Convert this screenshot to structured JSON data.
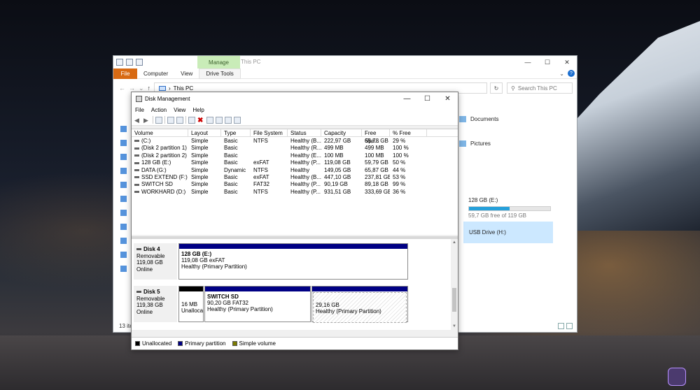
{
  "explorer": {
    "manage_tab": "Manage",
    "window_title": "This PC",
    "ribbon": {
      "file": "File",
      "computer": "Computer",
      "view": "View",
      "drive_tools": "Drive Tools"
    },
    "address": "This PC",
    "search_placeholder": "Search This PC",
    "folders": {
      "documents": "Documents",
      "pictures": "Pictures"
    },
    "drive_e": {
      "name": "128 GB (E:)",
      "free": "59,7 GB free of 119 GB",
      "used_fraction": 0.5
    },
    "drive_h": {
      "name": "USB Drive (H:)"
    },
    "status": "13 ite"
  },
  "disk_management": {
    "title": "Disk Management",
    "menu": [
      "File",
      "Action",
      "View",
      "Help"
    ],
    "columns": [
      "Volume",
      "Layout",
      "Type",
      "File System",
      "Status",
      "Capacity",
      "Free Spa...",
      "% Free"
    ],
    "volumes": [
      [
        "(C:)",
        "Simple",
        "Basic",
        "NTFS",
        "Healthy (B...",
        "222,97 GB",
        "65,78 GB",
        "29 %"
      ],
      [
        "(Disk 2 partition 1)",
        "Simple",
        "Basic",
        "",
        "Healthy (R...",
        "499 MB",
        "499 MB",
        "100 %"
      ],
      [
        "(Disk 2 partition 2)",
        "Simple",
        "Basic",
        "",
        "Healthy (E...",
        "100 MB",
        "100 MB",
        "100 %"
      ],
      [
        "128 GB (E:)",
        "Simple",
        "Basic",
        "exFAT",
        "Healthy (P...",
        "119,08 GB",
        "59,79 GB",
        "50 %"
      ],
      [
        "DATA (G:)",
        "Simple",
        "Dynamic",
        "NTFS",
        "Healthy",
        "149,05 GB",
        "65,87 GB",
        "44 %"
      ],
      [
        "SSD EXTEND (F:)",
        "Simple",
        "Basic",
        "exFAT",
        "Healthy (B...",
        "447,10 GB",
        "237,81 GB",
        "53 %"
      ],
      [
        "SWITCH SD",
        "Simple",
        "Basic",
        "FAT32",
        "Healthy (P...",
        "90,19 GB",
        "89,18 GB",
        "99 %"
      ],
      [
        "WORKHARD (D:)",
        "Simple",
        "Basic",
        "NTFS",
        "Healthy (P...",
        "931,51 GB",
        "333,69 GB",
        "36 %"
      ]
    ],
    "disk4": {
      "name": "Disk 4",
      "type": "Removable",
      "size": "119,08 GB",
      "state": "Online",
      "partition": {
        "title": "128 GB  (E:)",
        "line2": "119,08 GB exFAT",
        "line3": "Healthy (Primary Partition)"
      }
    },
    "disk5": {
      "name": "Disk 5",
      "type": "Removable",
      "size": "119,38 GB",
      "state": "Online",
      "unalloc": {
        "line1": "16 MB",
        "line2": "Unalloca"
      },
      "switch": {
        "title": "SWITCH SD",
        "line2": "90,20 GB FAT32",
        "line3": "Healthy (Primary Partition)"
      },
      "third": {
        "line1": "29,16 GB",
        "line2": "Healthy (Primary Partition)"
      }
    },
    "legend": {
      "unallocated": "Unallocated",
      "primary": "Primary partition",
      "simple": "Simple volume"
    },
    "legend_colors": {
      "unallocated": "#000000",
      "primary": "#000084",
      "simple": "#7b7b00"
    }
  }
}
